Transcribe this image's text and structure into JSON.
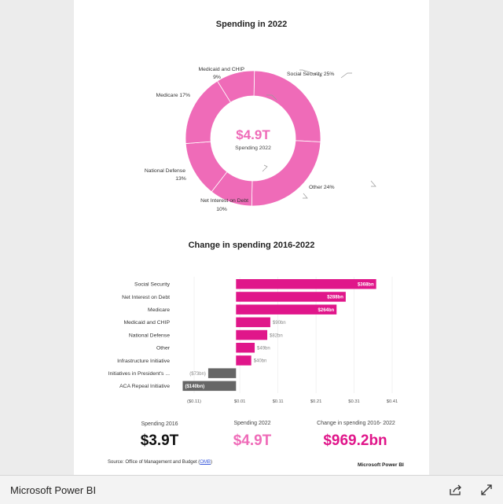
{
  "donut": {
    "title": "Spending in 2022",
    "center_value": "$4.9T",
    "center_label": "Spending 2022",
    "color": "#ef6bb8",
    "labels": {
      "social_security": "Social Security 25%",
      "other": "Other 24%",
      "net_interest_1": "Net Interest on Debt",
      "net_interest_2": "10%",
      "national_defense_1": "National Defense",
      "national_defense_2": "13%",
      "medicare": "Medicare 17%",
      "medicaid_1": "Medicaid and CHIP",
      "medicaid_2": "9%"
    }
  },
  "bars": {
    "title": "Change in spending 2016-2022",
    "ticks": [
      "($0.11)",
      "$0.01",
      "$0.11",
      "$0.21",
      "$0.31",
      "$0.41"
    ]
  },
  "chart_data": [
    {
      "type": "pie",
      "title": "Spending in 2022",
      "categories": [
        "Social Security",
        "Other",
        "Net Interest on Debt",
        "National Defense",
        "Medicare",
        "Medicaid and CHIP"
      ],
      "values": [
        25,
        24,
        10,
        13,
        17,
        9
      ],
      "unit": "%",
      "center_text": "$4.9T Spending 2022"
    },
    {
      "type": "bar",
      "orientation": "horizontal",
      "title": "Change in spending 2016-2022",
      "categories": [
        "Social Security",
        "Net Interest on Debt",
        "Medicare",
        "Medicaid and CHIP",
        "National Defense",
        "Other",
        "Infrastructure Initiative",
        "Initiatives in President's ...",
        "ACA Repeal Initiative"
      ],
      "values": [
        368,
        288,
        264,
        90,
        82,
        49,
        40,
        -73,
        -140
      ],
      "value_labels": [
        "$368bn",
        "$288bn",
        "$264bn",
        "$90bn",
        "$82bn",
        "$49bn",
        "$40bn",
        "($73bn)",
        "($140bn)"
      ],
      "colors": {
        "positive": "#e0168a",
        "negative": "#666666"
      },
      "unit": "$bn",
      "xlim": [
        -0.11,
        0.41
      ],
      "xlabel_ticks": [
        "($0.11)",
        "$0.01",
        "$0.11",
        "$0.21",
        "$0.31",
        "$0.41"
      ]
    }
  ],
  "kpis": [
    {
      "label": "Spending 2016",
      "value": "$3.9T",
      "color": "#111111"
    },
    {
      "label": "Spending 2022",
      "value": "$4.9T",
      "color": "#ef6bb8"
    },
    {
      "label": "Change in spending 2016- 2022",
      "value": "$969.2bn",
      "color": "#e0168a"
    }
  ],
  "footer": {
    "source_prefix": "Source: Office of Management and Budget (",
    "source_link": "OMB",
    "source_suffix": ")",
    "brand": "Microsoft Power BI"
  },
  "bottombar": {
    "app_title": "Microsoft Power BI",
    "share_icon": "share-icon",
    "expand_icon": "expand-icon"
  }
}
